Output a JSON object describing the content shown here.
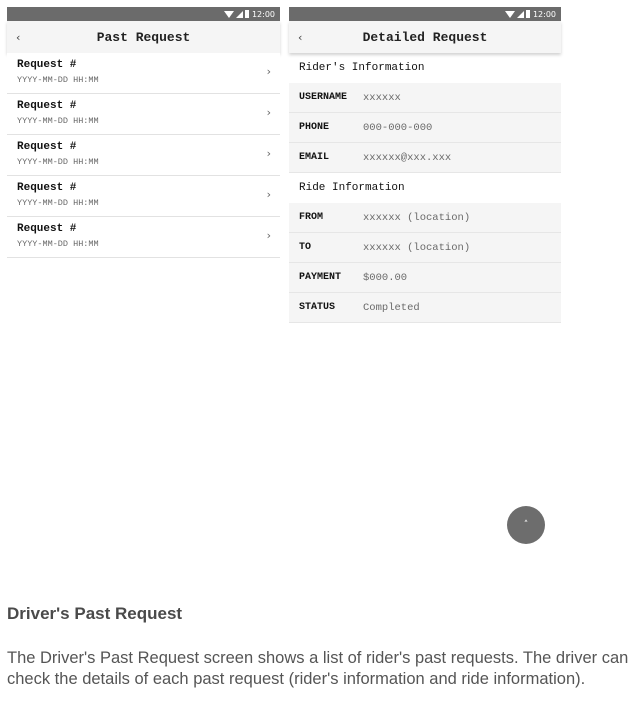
{
  "status_bar": {
    "time": "12:00"
  },
  "past_request_screen": {
    "title": "Past Request",
    "back_icon": "‹",
    "chevron_icon": "›",
    "requests": [
      {
        "title": "Request #",
        "datetime": "YYYY-MM-DD HH:MM"
      },
      {
        "title": "Request #",
        "datetime": "YYYY-MM-DD HH:MM"
      },
      {
        "title": "Request #",
        "datetime": "YYYY-MM-DD HH:MM"
      },
      {
        "title": "Request #",
        "datetime": "YYYY-MM-DD HH:MM"
      },
      {
        "title": "Request #",
        "datetime": "YYYY-MM-DD HH:MM"
      }
    ]
  },
  "detailed_request_screen": {
    "title": "Detailed Request",
    "back_icon": "‹",
    "rider_section": {
      "heading": "Rider's Information",
      "fields": [
        {
          "label": "USERNAME",
          "value": "xxxxxx"
        },
        {
          "label": "PHONE",
          "value": "000-000-000"
        },
        {
          "label": "EMAIL",
          "value": "xxxxxx@xxx.xxx"
        }
      ]
    },
    "ride_section": {
      "heading": "Ride Information",
      "fields": [
        {
          "label": "FROM",
          "value": "xxxxxx (location)"
        },
        {
          "label": "TO",
          "value": "xxxxxx (location)"
        },
        {
          "label": "PAYMENT",
          "value": "$000.00"
        },
        {
          "label": "STATUS",
          "value": "Completed"
        }
      ]
    }
  },
  "fab": {
    "icon": "˄",
    "icon_name": "scroll-to-top-icon"
  },
  "description": {
    "title": "Driver's Past Request",
    "body": "The Driver's Past Request screen shows a list of rider's past requests. The driver can check the details of each past request (rider's information and ride information)."
  },
  "colors": {
    "status_bar": "#6b6b6b",
    "app_bar": "#f5f5f5",
    "field_bg": "#f5f5f5",
    "fab": "#6d6d6d"
  }
}
